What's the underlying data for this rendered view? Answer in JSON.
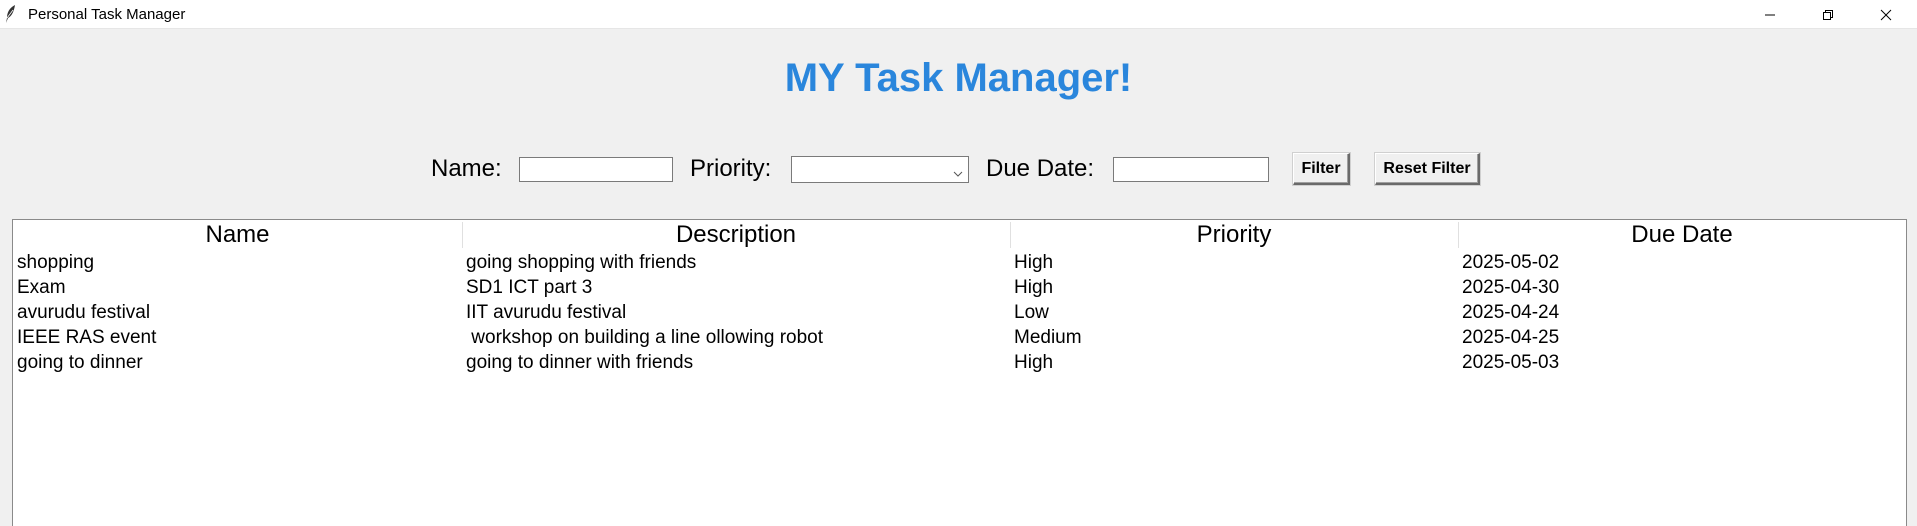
{
  "window": {
    "title": "Personal Task Manager",
    "icon": "feather-icon",
    "controls": [
      "minimize-icon",
      "restore-icon",
      "close-icon"
    ]
  },
  "heading": "MY Task Manager!",
  "colors": {
    "heading": "#2a86dc",
    "background": "#f0f0f0"
  },
  "filter": {
    "name_label": "Name:",
    "name_value": "",
    "priority_label": "Priority:",
    "priority_value": "",
    "due_date_label": "Due Date:",
    "due_date_value": "",
    "filter_button": "Filter",
    "reset_button": "Reset Filter"
  },
  "table": {
    "columns": [
      "Name",
      "Description",
      "Priority",
      "Due Date"
    ],
    "rows": [
      [
        "shopping",
        "going shopping with friends",
        "High",
        "2025-05-02"
      ],
      [
        "Exam",
        "SD1 ICT part 3",
        "High",
        "2025-04-30"
      ],
      [
        "avurudu festival",
        "IIT avurudu festival",
        "Low",
        "2025-04-24"
      ],
      [
        "IEEE RAS event",
        " workshop on building a line ollowing robot",
        "Medium",
        "2025-04-25"
      ],
      [
        "going to dinner",
        "going to dinner with friends",
        "High",
        "2025-05-03"
      ]
    ]
  }
}
